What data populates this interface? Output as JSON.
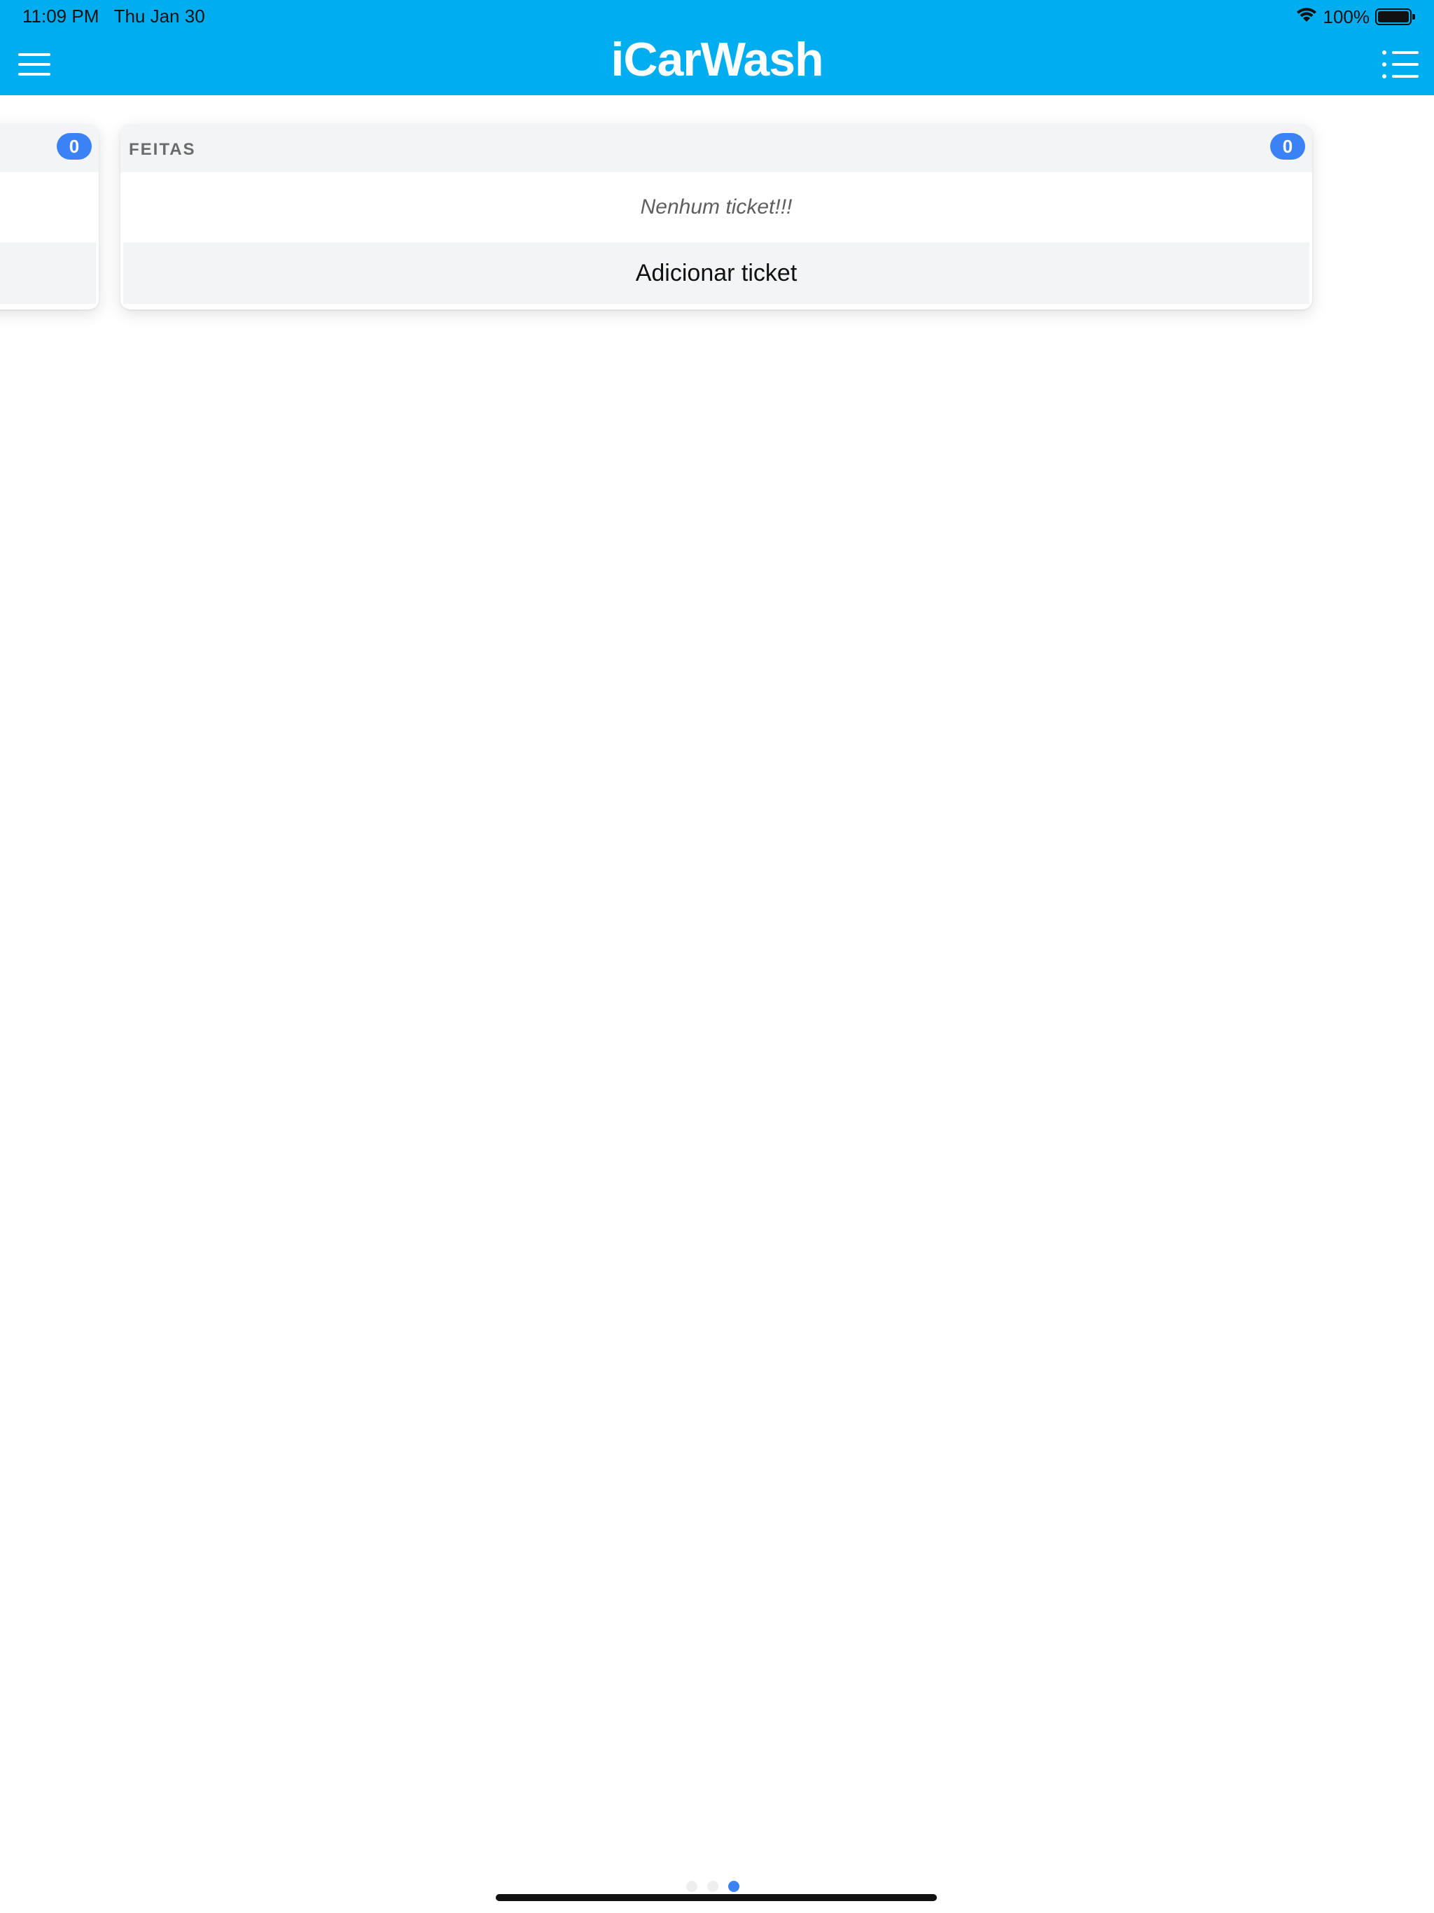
{
  "status_bar": {
    "time": "11:09 PM",
    "date": "Thu Jan 30",
    "battery_text": "100%",
    "battery_level": 1.0
  },
  "nav": {
    "brand": "iCarWash",
    "menu_icon": "hamburger-icon",
    "list_icon": "list-icon"
  },
  "board": {
    "left_column": {
      "count": "0"
    },
    "column": {
      "title": "FEITAS",
      "count": "0",
      "empty_message": "Nenhum ticket!!!",
      "add_button_label": "Adicionar ticket"
    }
  },
  "pager": {
    "page_count": 3,
    "active_index": 2
  },
  "colors": {
    "nav_bar": "#00aef0",
    "badge": "#3b82f6",
    "card_header": "#f3f4f6"
  }
}
